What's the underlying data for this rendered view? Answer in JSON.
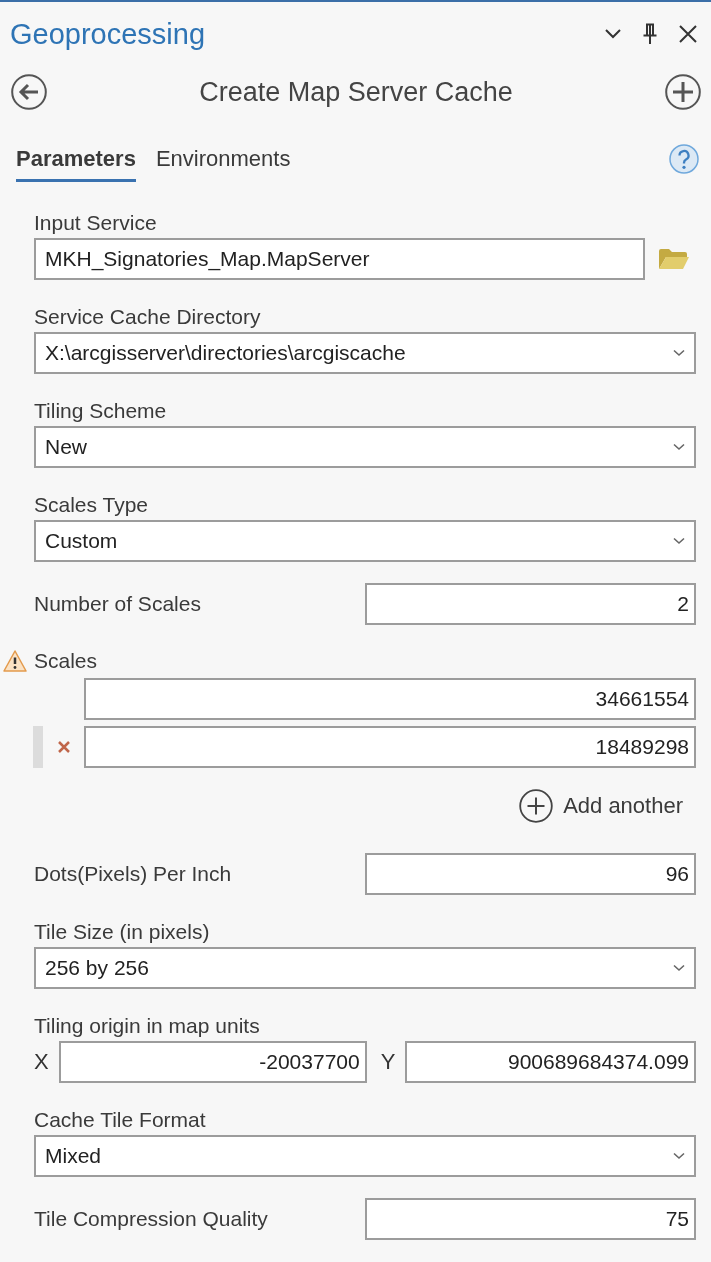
{
  "panel": {
    "title": "Geoprocessing"
  },
  "tool": {
    "title": "Create Map Server Cache"
  },
  "tabs": [
    {
      "label": "Parameters",
      "selected": true
    },
    {
      "label": "Environments",
      "selected": false
    }
  ],
  "parameters": [
    {
      "kind": "browse",
      "label": "Input Service",
      "value": "MKH_Signatories_Map.MapServer"
    },
    {
      "kind": "dropdown",
      "label": "Service Cache Directory",
      "value": "X:\\arcgisserver\\directories\\arcgiscache"
    },
    {
      "kind": "dropdown",
      "label": "Tiling Scheme",
      "value": "New"
    },
    {
      "kind": "dropdown",
      "label": "Scales Type",
      "value": "Custom"
    },
    {
      "kind": "number",
      "label": "Number of Scales",
      "value": "2"
    },
    {
      "kind": "list",
      "label": "Scales",
      "warning": true,
      "items": [
        {
          "value": "34661554",
          "selected": false
        },
        {
          "value": "18489298",
          "selected": true
        }
      ],
      "add_label": "Add another"
    },
    {
      "kind": "number",
      "label": "Dots(Pixels) Per Inch",
      "value": "96"
    },
    {
      "kind": "dropdown",
      "label": "Tile Size (in pixels)",
      "value": "256 by 256"
    },
    {
      "kind": "point",
      "label": "Tiling origin in map units",
      "x_label": "X",
      "x_value": "-20037700",
      "y_label": "Y",
      "y_value": "900689684374.099"
    },
    {
      "kind": "dropdown",
      "label": "Cache Tile Format",
      "value": "Mixed"
    },
    {
      "kind": "number",
      "label": "Tile Compression Quality",
      "value": "75"
    }
  ]
}
